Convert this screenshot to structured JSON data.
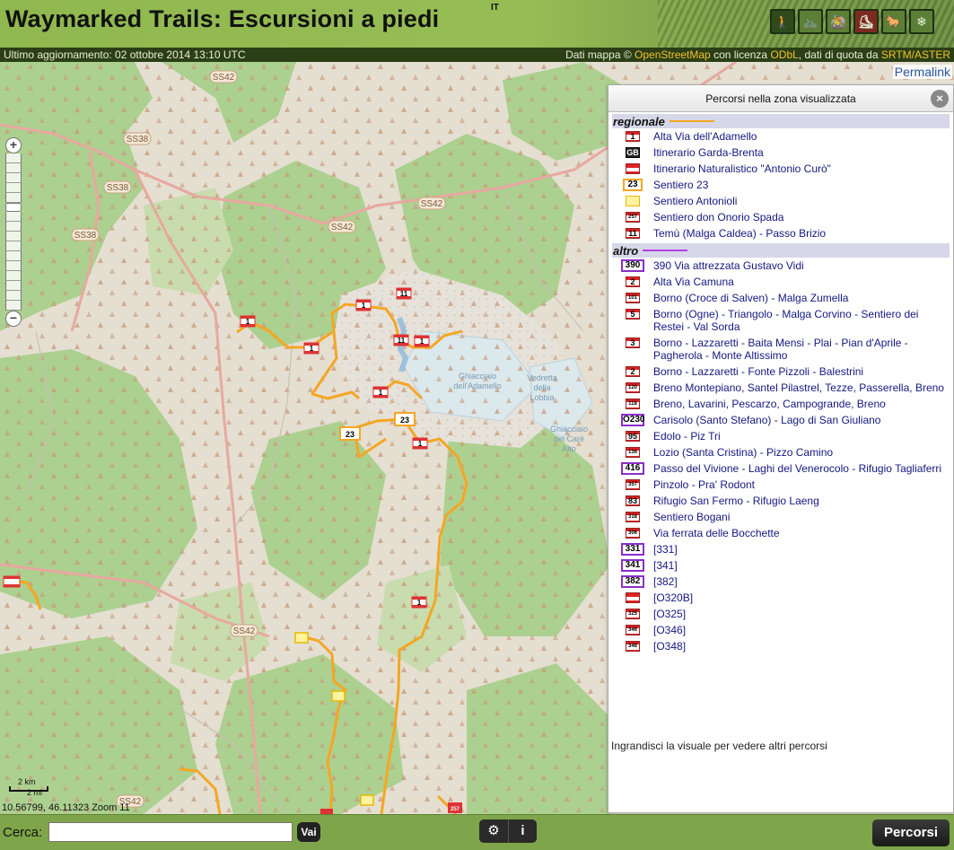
{
  "header": {
    "title": "Waymarked Trails: Escursioni a piedi",
    "lang": "IT",
    "route_types": [
      {
        "name": "hiking",
        "icon": "hiker-icon",
        "glyph": "🚶"
      },
      {
        "name": "cycling",
        "icon": "bicycle-icon",
        "glyph": "🚲"
      },
      {
        "name": "mtb",
        "icon": "mountain-bike-icon",
        "glyph": "🚵"
      },
      {
        "name": "skating",
        "icon": "skating-icon",
        "glyph": "⛸"
      },
      {
        "name": "riding",
        "icon": "horse-riding-icon",
        "glyph": "🐎"
      },
      {
        "name": "slopes",
        "icon": "ski-slopes-icon",
        "glyph": "❄"
      }
    ]
  },
  "infobar": {
    "updated": "Ultimo aggiornamento: 02 ottobre 2014 13:10 UTC",
    "attribution_prefix": "Dati mappa © ",
    "osm": "OpenStreetMap",
    "license_mid": " con licenza ",
    "odbl": "ODbL",
    "height_mid": ", dati di quota da ",
    "srtm": "SRTM/ASTER"
  },
  "map": {
    "permalink": "Permalink",
    "zoom_in": "+",
    "zoom_out": "−",
    "scale_km": "2 km",
    "scale_mi": "2 mi",
    "coords": "10.56799, 46.11323 Zoom 11",
    "road_labels": [
      "SS42",
      "SS38",
      "SS38",
      "SS38",
      "SS42",
      "SS42",
      "SS42",
      "SS42"
    ],
    "place_labels": [
      "Ghiacciaio dell'Adamello",
      "Vedretta della Lobbia",
      "Ghiacciaio del Carè Alto"
    ],
    "marker_labels": [
      "23",
      "23"
    ]
  },
  "panel": {
    "title": "Percorsi nella zona visualizzata",
    "close": "×",
    "groups": [
      {
        "name": "regionale",
        "color": "#f5a623",
        "routes": [
          {
            "sym": "1",
            "style": "red-white-red",
            "label": "Alta Via dell'Adamello"
          },
          {
            "sym": "GB",
            "style": "black",
            "label": "Itinerario Garda-Brenta"
          },
          {
            "sym": "",
            "style": "red-white-red-plain",
            "label": "Itinerario Naturalistico \"Antonio Curò\""
          },
          {
            "sym": "23",
            "style": "orange-box",
            "label": "Sentiero 23"
          },
          {
            "sym": "",
            "style": "yellow",
            "label": "Sentiero Antonioli"
          },
          {
            "sym": "257",
            "style": "red-white-red",
            "label": "Sentiero don Onorio Spada"
          },
          {
            "sym": "11",
            "style": "red-white-red",
            "label": "Temù (Malga Caldea) - Passo Brizio"
          }
        ]
      },
      {
        "name": "altro",
        "color": "#b040e0",
        "routes": [
          {
            "sym": "390",
            "style": "purple-box",
            "label": "390 Via attrezzata Gustavo Vidi"
          },
          {
            "sym": "2",
            "style": "red-white-red",
            "label": "Alta Via Camuna"
          },
          {
            "sym": "101",
            "style": "red-white-red",
            "label": "Borno (Croce di Salven) - Malga Zumella"
          },
          {
            "sym": "5",
            "style": "red-white-red",
            "label": "Borno (Ogne) - Triangolo - Malga Corvino - Sentiero dei Restei - Val Sorda"
          },
          {
            "sym": "3",
            "style": "red-white-red",
            "label": "Borno - Lazzaretti - Baita Mensi - Plai - Pian d'Aprile - Pagherola - Monte Altissimo"
          },
          {
            "sym": "2",
            "style": "red-white-red",
            "label": "Borno - Lazzaretti - Fonte Pizzoli - Balestrini"
          },
          {
            "sym": "120",
            "style": "red-white-red",
            "label": "Breno Montepiano, Santel Pilastrel, Tezze, Passerella, Breno"
          },
          {
            "sym": "118",
            "style": "red-white-red",
            "label": "Breno, Lavarini, Pescarzo, Campogrande, Breno"
          },
          {
            "sym": "O230",
            "style": "purple-box",
            "label": "Carisolo (Santo Stefano) - Lago di San Giuliano"
          },
          {
            "sym": "95",
            "style": "red-white-red",
            "label": "Edolo - Piz Tri"
          },
          {
            "sym": "136",
            "style": "red-white-red",
            "label": "Lozio (Santa Cristina) - Pizzo Camino"
          },
          {
            "sym": "416",
            "style": "purple-box",
            "label": "Passo del Vivione - Laghi del Venerocolo - Rifugio Tagliaferri"
          },
          {
            "sym": "357",
            "style": "red-white-red",
            "label": "Pinzolo - Pra' Rodont"
          },
          {
            "sym": "83",
            "style": "red-white-red",
            "label": "Rifugio San Fermo - Rifugio Laeng"
          },
          {
            "sym": "318",
            "style": "red-white-red",
            "label": "Sentiero Bogani"
          },
          {
            "sym": "306",
            "style": "red-white-red",
            "label": "Via ferrata delle Bocchette"
          },
          {
            "sym": "331",
            "style": "purple-box",
            "label": "[331]"
          },
          {
            "sym": "341",
            "style": "purple-box",
            "label": "[341]"
          },
          {
            "sym": "382",
            "style": "purple-box",
            "label": "[382]"
          },
          {
            "sym": "",
            "style": "red-white-red-plain",
            "label": "[O320B]"
          },
          {
            "sym": "325",
            "style": "red-white-red",
            "label": "[O325]"
          },
          {
            "sym": "346",
            "style": "red-white-red",
            "label": "[O346]"
          },
          {
            "sym": "348",
            "style": "red-white-red",
            "label": "[O348]"
          }
        ]
      }
    ],
    "note": "Ingrandisci la visuale per vedere altri percorsi"
  },
  "footer": {
    "search_label": "Cerca:",
    "search_value": "",
    "search_button": "Vai",
    "settings_glyph": "⚙",
    "info_glyph": "i",
    "routes_button": "Percorsi"
  }
}
